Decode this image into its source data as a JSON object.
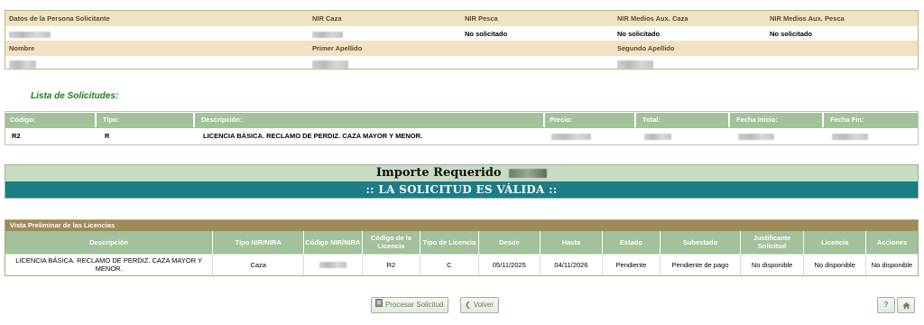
{
  "applicant": {
    "headers1": [
      "Datos de la Persona Solicitante",
      "NIR Caza",
      "NIR Pesca",
      "NIR Medios Aux. Caza",
      "NIR Medios Aux. Pesca"
    ],
    "values1": [
      "",
      "",
      "No solicitado",
      "No solicitado",
      "No solicitado"
    ],
    "headers2": [
      "Nombre",
      "Primer Apellido",
      "Segundo Apellido"
    ]
  },
  "lista": {
    "title": "Lista de Solicitudes:",
    "headers": [
      "Código:",
      "Tipo:",
      "Descripción:",
      "Precio:",
      "Total:",
      "Fecha Inicio:",
      "Fecha Fin:"
    ],
    "row": [
      "R2",
      "R",
      "LICENCIA BÁSICA. RECLAMO DE PERDIZ. CAZA MAYOR Y MENOR."
    ]
  },
  "importe": {
    "label": "Importe Requerido",
    "status": ":: LA SOLICITUD ES VÁLIDA ::"
  },
  "vista": {
    "caption": "Vista Preliminar de las Licencias",
    "headers": [
      "Descripción",
      "Tipo NIR/NIRA",
      "Código NIR/NIRA",
      "Código de la Licencia",
      "Tipo de Licencia",
      "Desde",
      "Hasta",
      "Estado",
      "Subestado",
      "Justificante Solicitud",
      "Licencia",
      "Acciones"
    ],
    "row": [
      "LICENCIA BÁSICA. RECLAMO DE PERDIZ. CAZA MAYOR Y MENOR.",
      "Caza",
      "",
      "R2",
      "C",
      "05/11/2025",
      "04/11/2026",
      "Pendiente",
      "Pendiente de pago",
      "No disponible",
      "No disponible",
      "No disponible"
    ]
  },
  "buttons": {
    "procesar": "Procesar Solicitud",
    "volver": "Volver",
    "help": "?",
    "home_icon": "home-icon"
  }
}
